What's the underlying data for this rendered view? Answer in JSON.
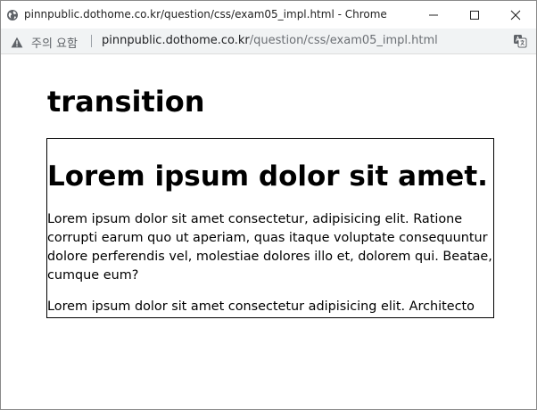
{
  "window": {
    "title": "pinnpublic.dothome.co.kr/question/css/exam05_impl.html - Chrome"
  },
  "addressbar": {
    "security_warning": "주의 요함",
    "url_host": "pinnpublic.dothome.co.kr",
    "url_path": "/question/css/exam05_impl.html"
  },
  "icons": {
    "site": "globe-icon",
    "warning": "warning-triangle-icon",
    "translate": "translate-icon",
    "minimize": "minimize-icon",
    "maximize": "maximize-icon",
    "close": "close-icon"
  },
  "page": {
    "heading": "transition",
    "box": {
      "heading": "Lorem ipsum dolor sit amet.",
      "paragraphs": [
        "Lorem ipsum dolor sit amet consectetur, adipisicing elit. Ratione corrupti earum quo ut aperiam, quas itaque voluptate consequuntur dolore perferendis vel, molestiae dolores illo et, dolorem qui. Beatae, cumque eum?",
        "Lorem ipsum dolor sit amet consectetur adipisicing elit. Architecto"
      ]
    }
  }
}
